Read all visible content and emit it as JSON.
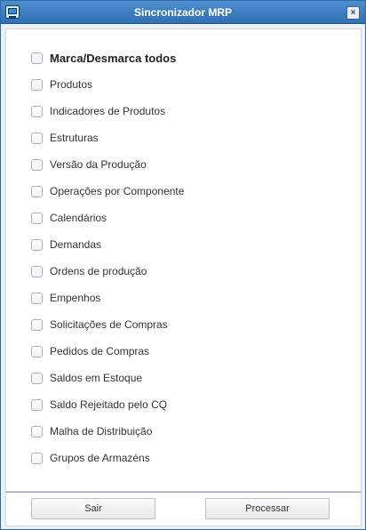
{
  "window": {
    "title": "Sincronizador MRP",
    "close_glyph": "×"
  },
  "options": [
    {
      "label": "Marca/Desmarca todos",
      "checked": false,
      "bold": true
    },
    {
      "label": "Produtos",
      "checked": false
    },
    {
      "label": "Indicadores de Produtos",
      "checked": false
    },
    {
      "label": "Estruturas",
      "checked": false
    },
    {
      "label": "Versão da Produção",
      "checked": false
    },
    {
      "label": "Operações por Componente",
      "checked": false
    },
    {
      "label": "Calendários",
      "checked": false
    },
    {
      "label": "Demandas",
      "checked": false
    },
    {
      "label": "Ordens de produção",
      "checked": false
    },
    {
      "label": "Empenhos",
      "checked": false
    },
    {
      "label": "Solicitações de Compras",
      "checked": false
    },
    {
      "label": "Pedidos de Compras",
      "checked": false
    },
    {
      "label": "Saldos em Estoque",
      "checked": false
    },
    {
      "label": "Saldo Rejeitado pelo CQ",
      "checked": false
    },
    {
      "label": "Malha de Distribuição",
      "checked": false
    },
    {
      "label": "Grupos de Armazéns",
      "checked": false
    }
  ],
  "buttons": {
    "exit": "Sair",
    "process": "Processar"
  },
  "colors": {
    "titlebar": "#2f6fb2",
    "title_text": "#ffffff",
    "background": "#eef2f7"
  }
}
